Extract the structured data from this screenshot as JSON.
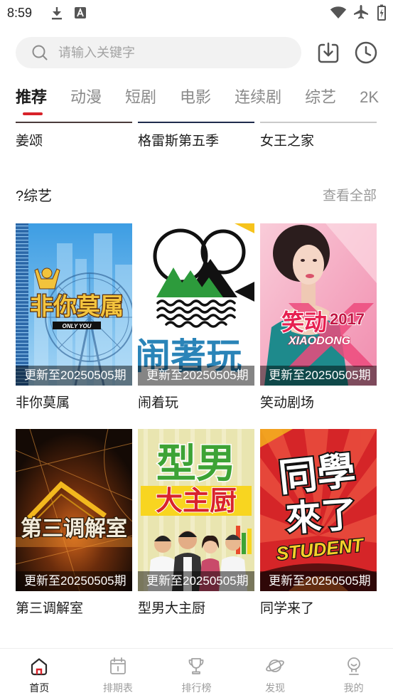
{
  "status_bar": {
    "time": "8:59",
    "icons_left": [
      "download-icon",
      "text-a-icon"
    ],
    "icons_right": [
      "wifi-icon",
      "airplane-icon",
      "battery-charging-icon"
    ]
  },
  "search": {
    "placeholder": "请输入关键字",
    "icon": "search-icon"
  },
  "header_actions": [
    {
      "icon": "download-icon"
    },
    {
      "icon": "history-icon"
    }
  ],
  "tabs": [
    {
      "label": "推荐",
      "active": true
    },
    {
      "label": "动漫"
    },
    {
      "label": "短剧"
    },
    {
      "label": "电影"
    },
    {
      "label": "连续剧"
    },
    {
      "label": "综艺"
    },
    {
      "label": "2K"
    }
  ],
  "previous_row": {
    "titles": [
      "姜颂",
      "格雷斯第五季",
      "女王之家"
    ]
  },
  "section": {
    "title": "?综艺",
    "more": "查看全部",
    "items": [
      {
        "title": "非你莫属",
        "badge": "更新至20250505期",
        "poster_text": [
          "非你莫属",
          "ONLY YOU"
        ]
      },
      {
        "title": "闹着玩",
        "badge": "更新至20250505期",
        "poster_text": [
          "闹著玩"
        ]
      },
      {
        "title": "笑动剧场",
        "badge": "更新至20250505期",
        "poster_text": [
          "笑动",
          "2017",
          "XIAODONG"
        ]
      },
      {
        "title": "第三调解室",
        "badge": "更新至20250505期",
        "poster_text": [
          "第三调解室"
        ]
      },
      {
        "title": "型男大主厨",
        "badge": "更新至20250505期",
        "poster_text": [
          "型男",
          "大主厨"
        ]
      },
      {
        "title": "同学来了",
        "badge": "更新至20250505期",
        "poster_text": [
          "同學",
          "來了",
          "STUDENT"
        ]
      }
    ]
  },
  "bottom_nav": [
    {
      "label": "首页",
      "icon": "home-icon",
      "active": true
    },
    {
      "label": "排期表",
      "icon": "calendar-icon"
    },
    {
      "label": "排行榜",
      "icon": "trophy-icon"
    },
    {
      "label": "发现",
      "icon": "planet-icon"
    },
    {
      "label": "我的",
      "icon": "user-icon"
    }
  ],
  "colors": {
    "accent": "#d8232a",
    "text": "#1c1c1c",
    "muted": "#9a9a9a",
    "search_bg": "#f2f2f2",
    "badge_bg": "rgba(0,0,0,0.48)"
  }
}
